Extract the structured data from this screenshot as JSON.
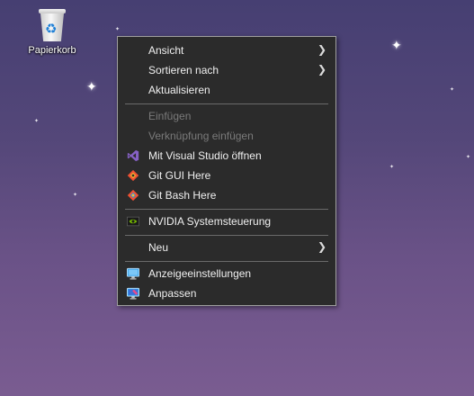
{
  "desktop": {
    "recycle_bin_label": "Papierkorb"
  },
  "context_menu": {
    "items": [
      {
        "label": "Ansicht",
        "submenu": true,
        "enabled": true
      },
      {
        "label": "Sortieren nach",
        "submenu": true,
        "enabled": true
      },
      {
        "label": "Aktualisieren",
        "enabled": true
      },
      {
        "label": "Einfügen",
        "enabled": false
      },
      {
        "label": "Verknüpfung einfügen",
        "enabled": false
      },
      {
        "label": "Mit Visual Studio öffnen",
        "icon": "visual-studio-icon",
        "enabled": true
      },
      {
        "label": "Git GUI Here",
        "icon": "git-gui-icon",
        "enabled": true
      },
      {
        "label": "Git Bash Here",
        "icon": "git-bash-icon",
        "enabled": true
      },
      {
        "label": "NVIDIA Systemsteuerung",
        "icon": "nvidia-icon",
        "enabled": true
      },
      {
        "label": "Neu",
        "submenu": true,
        "enabled": true
      },
      {
        "label": "Anzeigeeinstellungen",
        "icon": "display-settings-icon",
        "enabled": true
      },
      {
        "label": "Anpassen",
        "icon": "personalize-icon",
        "enabled": true
      }
    ]
  },
  "colors": {
    "menu_background": "#2b2b2b",
    "menu_text": "#f0f0f0",
    "menu_disabled_text": "#7a7a7a",
    "visual_studio_purple": "#8661c5",
    "git_orange": "#f05133",
    "nvidia_green": "#76b900"
  }
}
